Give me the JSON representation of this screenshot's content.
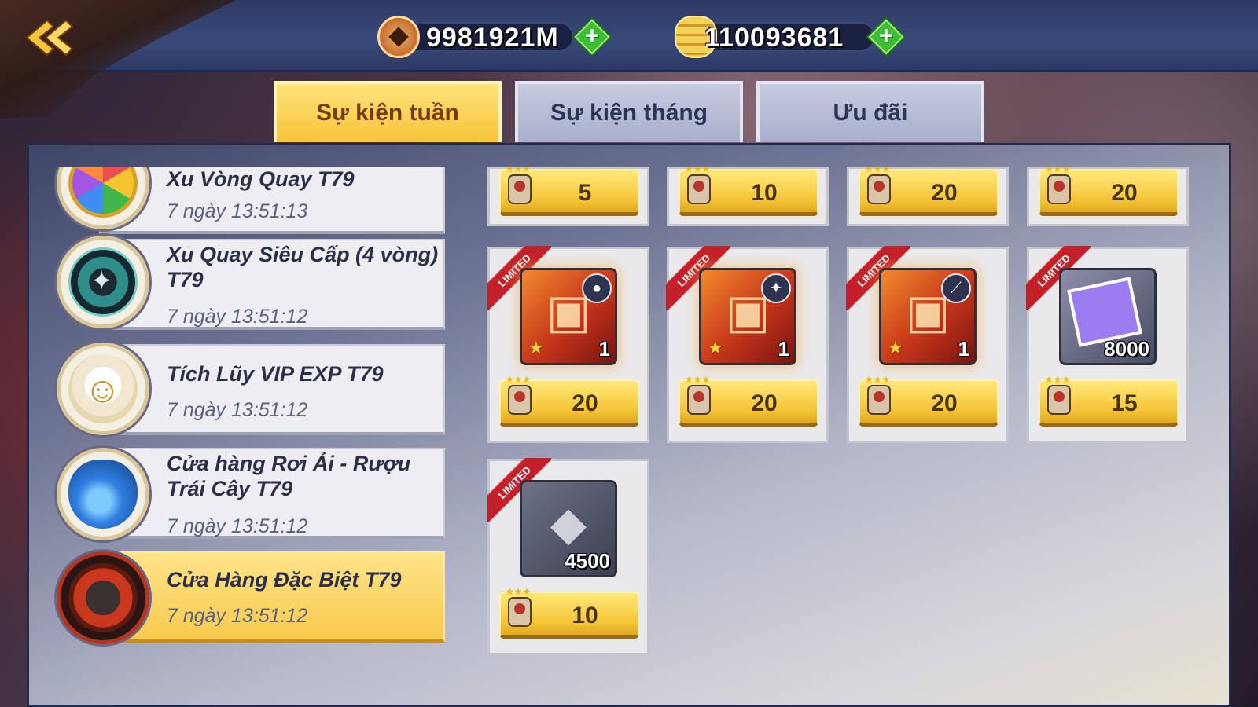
{
  "currencies": {
    "copper": {
      "value": "9981921M",
      "icon": "copper-coin-icon"
    },
    "gold": {
      "value": "110093681",
      "icon": "gold-coin-stack-icon"
    }
  },
  "tabs": [
    {
      "label": "Sự kiện tuần",
      "active": true
    },
    {
      "label": "Sự kiện tháng",
      "active": false
    },
    {
      "label": "Ưu đãi",
      "active": false
    }
  ],
  "events": [
    {
      "title": "Xu Vòng Quay T79",
      "timer": "7 ngày 13:51:13",
      "icon": "wheel-icon",
      "active": false
    },
    {
      "title": "Xu Quay Siêu Cấp (4 vòng) T79",
      "timer": "7 ngày 13:51:12",
      "icon": "shuriken-chip-icon",
      "active": false
    },
    {
      "title": "Tích Lũy VIP EXP T79",
      "timer": "7 ngày 13:51:12",
      "icon": "lucky-cat-icon",
      "active": false
    },
    {
      "title": "Cửa hàng Rơi Ải - Rượu Trái Cây T79",
      "timer": "7 ngày 13:51:12",
      "icon": "potion-bottle-icon",
      "active": false
    },
    {
      "title": "Cửa Hàng Đặc Biệt T79",
      "timer": "7 ngày 13:51:12",
      "icon": "fire-fox-icon",
      "active": true
    }
  ],
  "shop": {
    "limited_label": "LIMITED",
    "top_row": [
      {
        "price": "5"
      },
      {
        "price": "10"
      },
      {
        "price": "20"
      },
      {
        "price": "20"
      }
    ],
    "items": [
      {
        "type": "chest",
        "badge": "bomb-icon",
        "qty": "1",
        "price": "20",
        "limited": true
      },
      {
        "type": "chest",
        "badge": "shuriken-icon",
        "qty": "1",
        "price": "20",
        "limited": true
      },
      {
        "type": "chest",
        "badge": "kunai-icon",
        "qty": "1",
        "price": "20",
        "limited": true
      },
      {
        "type": "card",
        "badge": "",
        "qty": "8000",
        "price": "15",
        "limited": true
      },
      {
        "type": "ore",
        "badge": "",
        "qty": "4500",
        "price": "10",
        "limited": true
      }
    ]
  },
  "colors": {
    "accent_gold": "#f7c53a",
    "limited_red": "#c4202a",
    "plus_green": "#3bbd34"
  }
}
